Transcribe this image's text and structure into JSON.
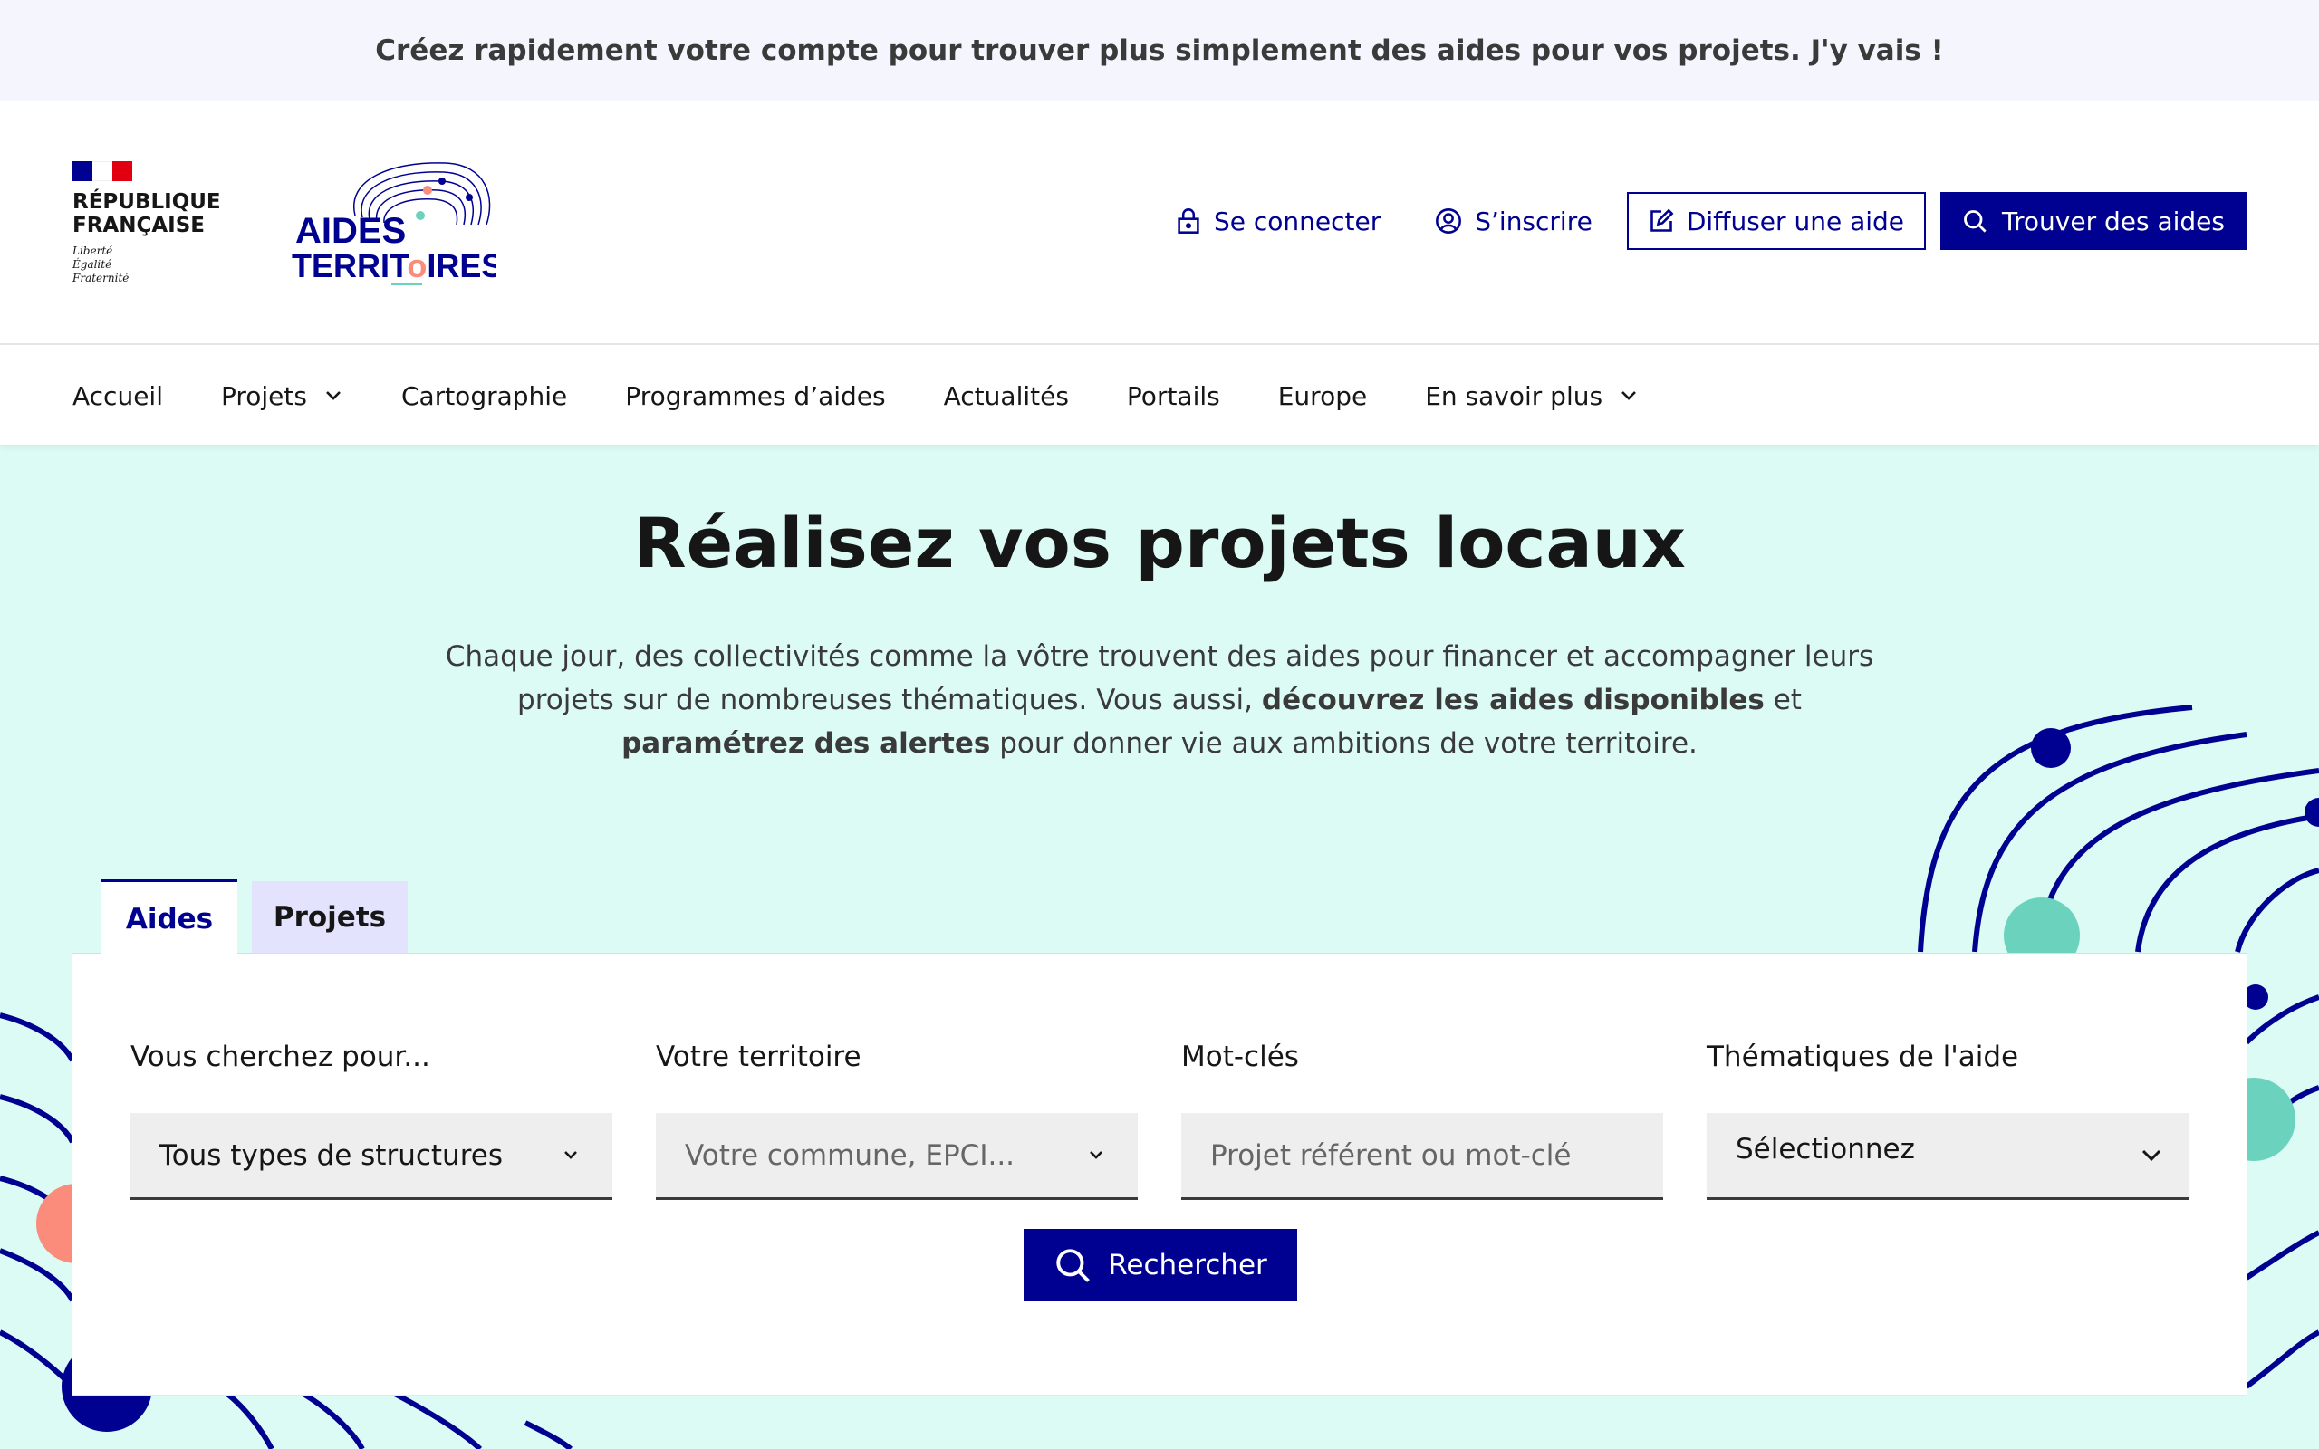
{
  "banner": {
    "text": "Créez rapidement votre compte pour trouver plus simplement des aides pour vos projets. J'y vais !"
  },
  "header": {
    "rf_line1": "RÉPUBLIQUE",
    "rf_line2": "FRANÇAISE",
    "motto": [
      "Liberté",
      "Égalité",
      "Fraternité"
    ],
    "logo_line1": "AIDES",
    "logo_line2": "TERRIT",
    "logo_line2b": "IRES",
    "links": {
      "login": "Se connecter",
      "signup": "S’inscrire",
      "publish": "Diffuser une aide",
      "find": "Trouver des aides"
    }
  },
  "nav": {
    "items": [
      "Accueil",
      "Projets",
      "Cartographie",
      "Programmes d’aides",
      "Actualités",
      "Portails",
      "Europe",
      "En savoir plus"
    ]
  },
  "hero": {
    "title": "Réalisez vos projets locaux",
    "desc_part1": "Chaque jour, des collectivités comme la vôtre trouvent des aides pour financer et accompagner leurs projets sur de nombreuses thématiques. Vous aussi, ",
    "desc_bold1": "découvrez les aides disponibles",
    "desc_part2": " et ",
    "desc_bold2": "paramétrez des alertes",
    "desc_part3": " pour donner vie aux ambitions de votre territoire."
  },
  "tabs": {
    "aides": "Aides",
    "projets": "Projets"
  },
  "search": {
    "structure_label": "Vous cherchez pour...",
    "structure_value": "Tous types de structures",
    "territory_label": "Votre territoire",
    "territory_placeholder": "Votre commune, EPCI...",
    "keywords_label": "Mot-clés",
    "keywords_placeholder": "Projet référent ou mot-clé",
    "theme_label": "Thématiques de l'aide",
    "theme_value": "Sélectionnez",
    "button": "Rechercher"
  },
  "colors": {
    "primary": "#000091",
    "hero_bg": "#dcfbf5",
    "banner_bg": "#f5f5fe",
    "tab_inactive": "#e3e3fd",
    "accent_teal": "#6bd2be",
    "accent_coral": "#fb8b7a",
    "flag_red": "#e1000f"
  },
  "icons": {
    "login": "lock-icon",
    "signup": "user-circle-icon",
    "publish": "edit-box-icon",
    "find": "search-icon",
    "dropdown": "chevron-down-icon"
  }
}
